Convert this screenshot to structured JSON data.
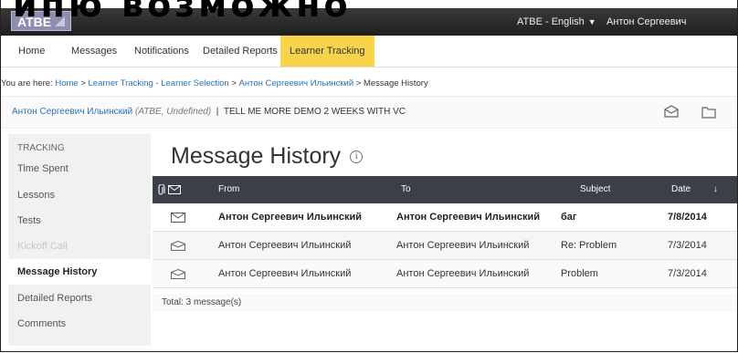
{
  "overlay_text": "ипю возможно",
  "app": {
    "logo": "ATBE",
    "language": "ATBE - English",
    "user": "Антон Сергеевич Ильинский"
  },
  "nav": [
    "Home",
    "Messages",
    "Notifications",
    "Detailed Reports",
    "Learner Tracking"
  ],
  "breadcrumb": {
    "prefix": "You are here:",
    "links": [
      "Home",
      "Learner Tracking - Learner Selection",
      "Антон Сергеевич Ильинский"
    ],
    "current": "Message History"
  },
  "learner": {
    "name": "Антон Сергеевич Ильинский",
    "org": "(ATBE, Undefined)",
    "course": "TELL ME MORE DEMO 2 WEEKS WITH VC"
  },
  "sidebar": {
    "heading": "TRACKING",
    "items": [
      "Time Spent",
      "Lessons",
      "Tests",
      "Kickoff Call",
      "Message History",
      "Detailed Reports",
      "Comments"
    ]
  },
  "page": {
    "title": "Message History",
    "info_icon": "i"
  },
  "table": {
    "headers": {
      "from": "From",
      "to": "To",
      "subject": "Subject",
      "date": "Date",
      "sort": "↓"
    },
    "rows": [
      {
        "from": "Антон Сергеевич Ильинский",
        "to": "Антон Сергеевич Ильинский",
        "subject": "баг",
        "date": "7/8/2014",
        "status": "unread"
      },
      {
        "from": "Антон Сергеевич Ильинский",
        "to": "Антон Сергеевич Ильинский",
        "subject": "Re: Problem",
        "date": "7/3/2014",
        "status": "read"
      },
      {
        "from": "Антон Сергеевич Ильинский",
        "to": "Антон Сергеевич Ильинский",
        "subject": "Problem",
        "date": "7/3/2014",
        "status": "read"
      }
    ],
    "total": "Total: 3 message(s)"
  }
}
